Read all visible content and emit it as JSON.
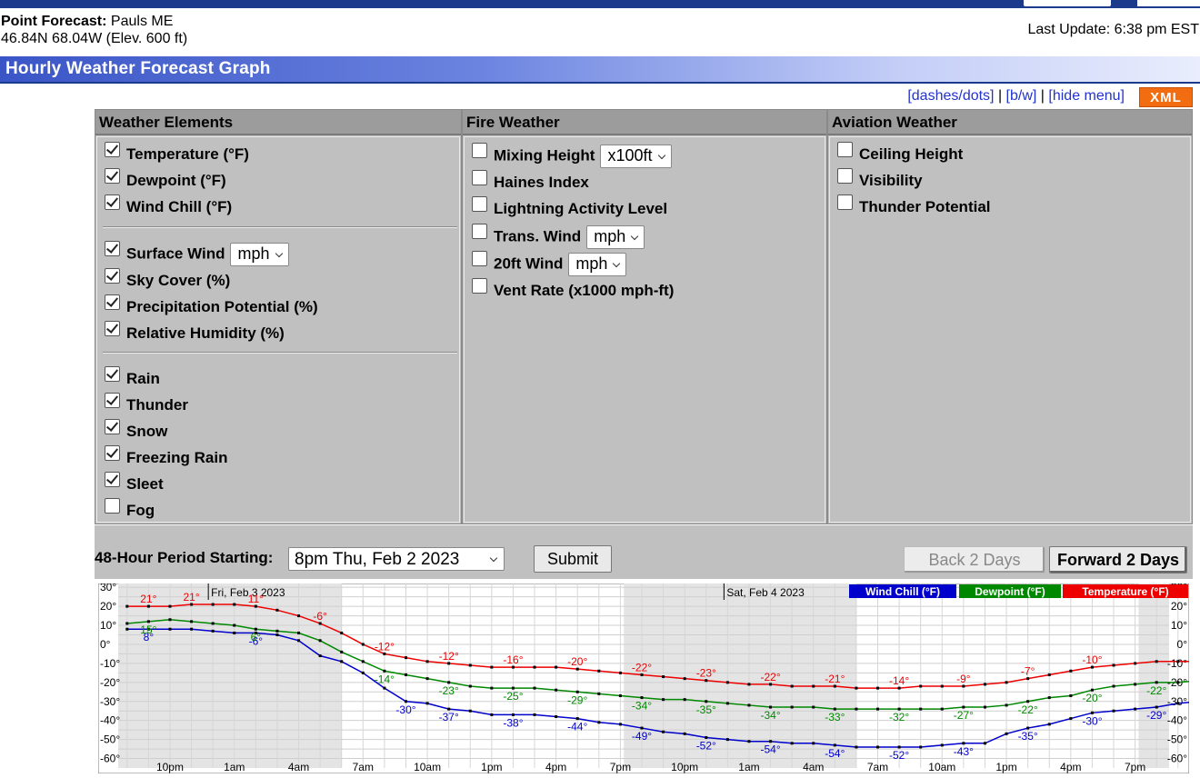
{
  "header": {
    "point_forecast_label": "Point Forecast:",
    "location": "Pauls ME",
    "coords": "46.84N 68.04W (Elev. 600 ft)",
    "last_update": "Last Update: 6:38 pm EST"
  },
  "banner": {
    "title": "Hourly Weather Forecast Graph"
  },
  "links": {
    "dashes": "[dashes/dots]",
    "sep1": " | ",
    "bw": "[b/w]",
    "sep2": " | ",
    "hide": "[hide menu]",
    "xml": "XML"
  },
  "menu": {
    "weather": {
      "title": "Weather Elements",
      "items": [
        {
          "label": "Temperature (°F)",
          "checked": true
        },
        {
          "label": "Dewpoint (°F)",
          "checked": true
        },
        {
          "label": "Wind Chill (°F)",
          "checked": true
        },
        {
          "label": "Surface Wind",
          "checked": true,
          "select": "mph"
        },
        {
          "label": "Sky Cover (%)",
          "checked": true
        },
        {
          "label": "Precipitation Potential (%)",
          "checked": true
        },
        {
          "label": "Relative Humidity (%)",
          "checked": true
        },
        {
          "label": "Rain",
          "checked": true
        },
        {
          "label": "Thunder",
          "checked": true
        },
        {
          "label": "Snow",
          "checked": true
        },
        {
          "label": "Freezing Rain",
          "checked": true
        },
        {
          "label": "Sleet",
          "checked": true
        },
        {
          "label": "Fog",
          "checked": false
        }
      ]
    },
    "fire": {
      "title": "Fire Weather",
      "items": [
        {
          "label": "Mixing Height",
          "checked": false,
          "select": "x100ft"
        },
        {
          "label": "Haines Index",
          "checked": false
        },
        {
          "label": "Lightning Activity Level",
          "checked": false
        },
        {
          "label": "Trans. Wind",
          "checked": false,
          "select": "mph"
        },
        {
          "label": "20ft Wind",
          "checked": false,
          "select": "mph"
        },
        {
          "label": "Vent Rate (x1000 mph-ft)",
          "checked": false
        }
      ]
    },
    "aviation": {
      "title": "Aviation Weather",
      "items": [
        {
          "label": "Ceiling Height",
          "checked": false
        },
        {
          "label": "Visibility",
          "checked": false
        },
        {
          "label": "Thunder Potential",
          "checked": false
        }
      ]
    }
  },
  "period": {
    "label": "48-Hour Period Starting:",
    "value": "8pm Thu, Feb 2 2023",
    "submit": "Submit",
    "back": "Back 2 Days",
    "forward": "Forward 2 Days"
  },
  "colors": {
    "wind_chill": "#0000cc",
    "dewpoint": "#008800",
    "temperature": "#ee0000",
    "night_shade": "#e4e4e4"
  },
  "chart_data": {
    "type": "line",
    "day_labels": [
      "Fri, Feb 3 2023",
      "Sat, Feb 4 2023"
    ],
    "ylim": [
      -65,
      32
    ],
    "y_ticks": [
      30,
      20,
      10,
      0,
      -10,
      -20,
      -30,
      -40,
      -50,
      -60
    ],
    "y_tick_labels": [
      "30°",
      "20°",
      "10°",
      "0°",
      "-10°",
      "-20°",
      "-30°",
      "-40°",
      "-50°",
      "-60°"
    ],
    "x_tick_labels": [
      "10pm",
      "1am",
      "4am",
      "7am",
      "10am",
      "1pm",
      "4pm",
      "7pm",
      "10pm",
      "1am",
      "4am",
      "7am",
      "10am",
      "1pm",
      "4pm",
      "7pm"
    ],
    "series": [
      {
        "name": "Wind Chill (°F)",
        "values": [
          8,
          8,
          8,
          8,
          7,
          6,
          6,
          5,
          2,
          -6,
          -9,
          -15,
          -23,
          -30,
          -31,
          -34,
          -35,
          -37,
          -37,
          -37,
          -38,
          -39,
          -41,
          -42,
          -44,
          -46,
          -47,
          -49,
          -50,
          -51,
          -51,
          -52,
          -52,
          -53,
          -54,
          -54,
          -54,
          -54,
          -53,
          -52,
          -52,
          -47,
          -44,
          -42,
          -39,
          -36,
          -35,
          -34,
          -33,
          -31,
          -30,
          -29,
          -29,
          -28
        ],
        "labels": [
          [
            1,
            "8°"
          ],
          [
            6,
            "-6°"
          ],
          [
            13,
            "-30°"
          ],
          [
            15,
            "-37°"
          ],
          [
            18,
            "-38°"
          ],
          [
            21,
            "-44°"
          ],
          [
            24,
            "-49°"
          ],
          [
            27,
            "-52°"
          ],
          [
            30,
            "-54°"
          ],
          [
            33,
            "-54°"
          ],
          [
            36,
            "-52°"
          ],
          [
            39,
            "-43°"
          ],
          [
            42,
            "-35°"
          ],
          [
            45,
            "-30°"
          ],
          [
            48,
            "-29°"
          ]
        ]
      },
      {
        "name": "Dewpoint (°F)",
        "values": [
          11,
          12,
          13,
          12,
          11,
          10,
          8,
          7,
          6,
          2,
          -4,
          -9,
          -14,
          -16,
          -18,
          -20,
          -22,
          -23,
          -23,
          -23,
          -24,
          -25,
          -26,
          -27,
          -28,
          -29,
          -29,
          -30,
          -31,
          -32,
          -33,
          -33,
          -33,
          -34,
          -34,
          -34,
          -34,
          -34,
          -34,
          -33,
          -33,
          -32,
          -30,
          -28,
          -27,
          -24,
          -22,
          -21,
          -20,
          -20,
          -19,
          -20,
          -21,
          -22
        ],
        "labels": [
          [
            1,
            "15°"
          ],
          [
            6,
            "6°"
          ],
          [
            12,
            "-14°"
          ],
          [
            15,
            "-23°"
          ],
          [
            18,
            "-25°"
          ],
          [
            21,
            "-29°"
          ],
          [
            24,
            "-34°"
          ],
          [
            27,
            "-35°"
          ],
          [
            30,
            "-34°"
          ],
          [
            33,
            "-33°"
          ],
          [
            36,
            "-32°"
          ],
          [
            39,
            "-27°"
          ],
          [
            42,
            "-22°"
          ],
          [
            45,
            "-20°"
          ],
          [
            48,
            "-22°"
          ]
        ]
      },
      {
        "name": "Temperature (°F)",
        "values": [
          20,
          20,
          20,
          21,
          21,
          21,
          20,
          18,
          15,
          11,
          6,
          0,
          -5,
          -7,
          -9,
          -10,
          -11,
          -12,
          -12,
          -12,
          -12,
          -13,
          -14,
          -15,
          -16,
          -17,
          -18,
          -19,
          -20,
          -21,
          -21,
          -22,
          -22,
          -22,
          -23,
          -23,
          -23,
          -22,
          -22,
          -22,
          -21,
          -20,
          -18,
          -16,
          -14,
          -12,
          -11,
          -10,
          -9,
          -9,
          -9,
          -8,
          -8,
          -10
        ],
        "labels": [
          [
            1,
            "21°"
          ],
          [
            3,
            "21°"
          ],
          [
            6,
            "11°"
          ],
          [
            9,
            "-6°"
          ],
          [
            12,
            "-12°"
          ],
          [
            15,
            "-12°"
          ],
          [
            18,
            "-16°"
          ],
          [
            21,
            "-20°"
          ],
          [
            24,
            "-22°"
          ],
          [
            27,
            "-23°"
          ],
          [
            30,
            "-22°"
          ],
          [
            33,
            "-21°"
          ],
          [
            36,
            "-14°"
          ],
          [
            39,
            "-9°"
          ],
          [
            42,
            "-7°"
          ],
          [
            45,
            "-10°"
          ]
        ]
      }
    ]
  }
}
